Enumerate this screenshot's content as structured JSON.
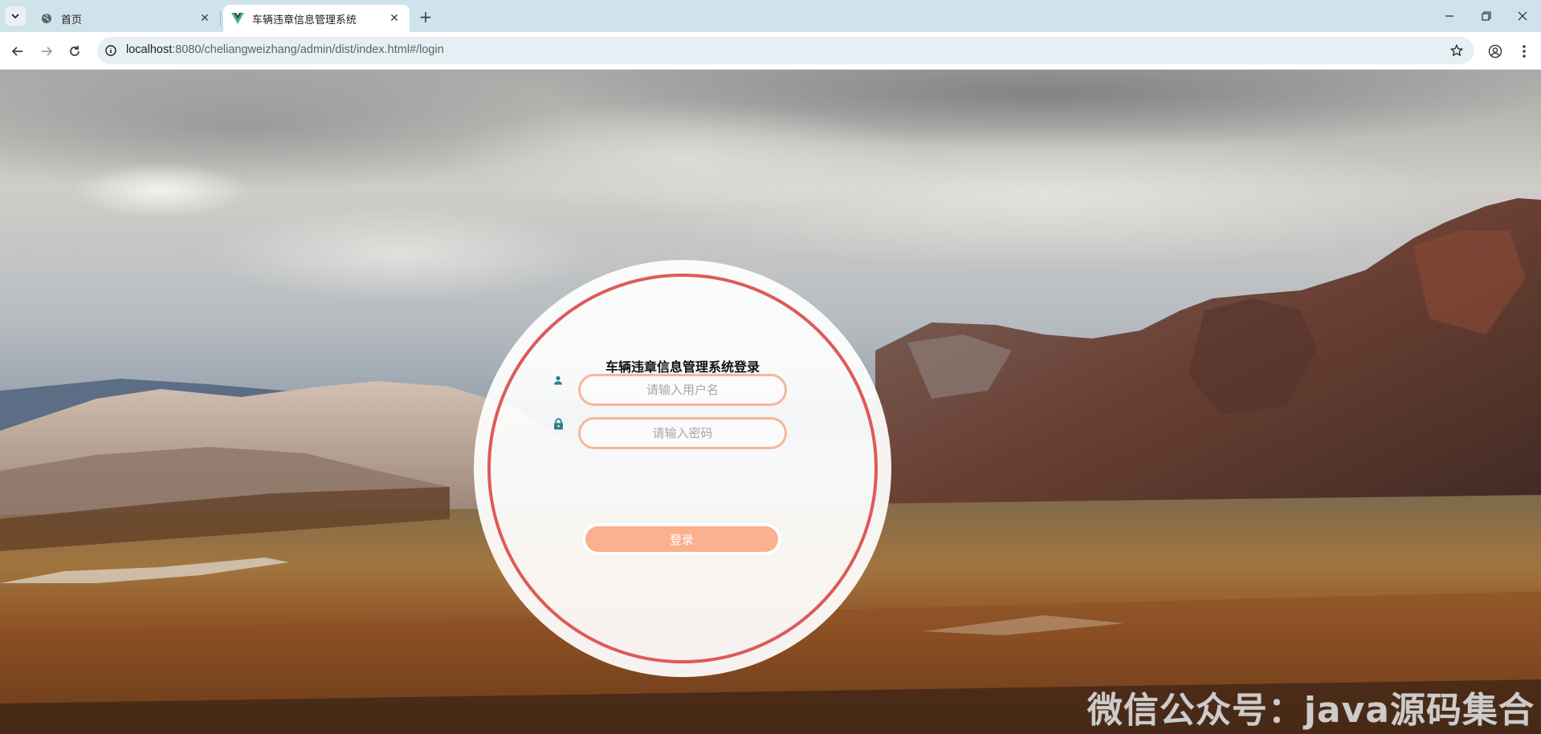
{
  "browser": {
    "tabs": [
      {
        "title": "首页",
        "icon": "globe-icon",
        "active": false
      },
      {
        "title": "车辆违章信息管理系统",
        "icon": "vue-logo-icon",
        "active": true
      }
    ],
    "address": {
      "host": "localhost",
      "path": ":8080/cheliangweizhang/admin/dist/index.html#/login"
    }
  },
  "login": {
    "title": "车辆违章信息管理系统登录",
    "username_placeholder": "请输入用户名",
    "password_placeholder": "请输入密码",
    "submit_label": "登录"
  },
  "watermark": "微信公众号：java源码集合",
  "colors": {
    "accent": "#fbb08e",
    "ring": "#de5a5a",
    "input_border": "#f5b797",
    "icon": "#2f7f8a"
  }
}
